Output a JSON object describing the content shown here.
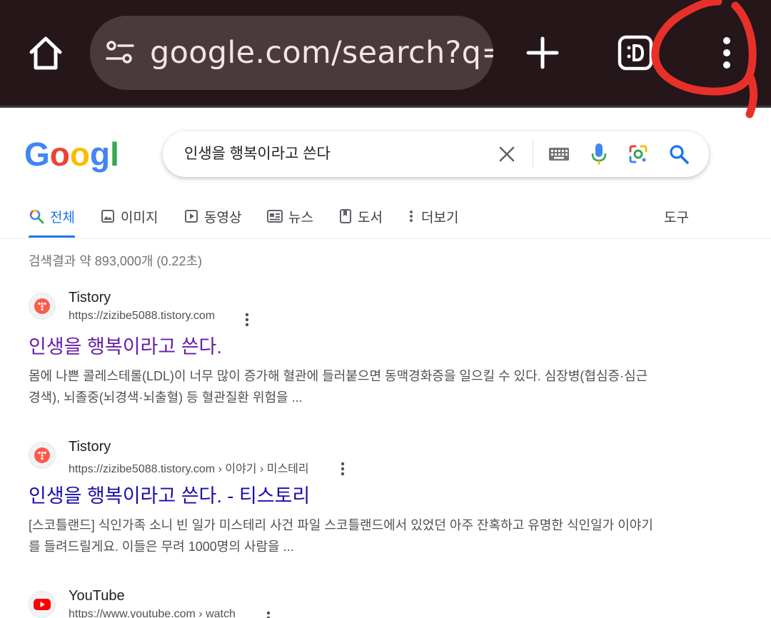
{
  "browser": {
    "url_display": "google.com/search?q=",
    "icons": [
      "home-icon",
      "site-settings-icon",
      "new-tab-icon",
      "tab-switcher-icon",
      "more-vert-icon"
    ],
    "colors": {
      "toolbar": "#241619",
      "url_pill": "#4a3a3c",
      "annotation": "#e8302b"
    }
  },
  "search": {
    "logo_text": "Google",
    "query": "인생을 행복이라고 쓴다"
  },
  "tabs": [
    {
      "label": "전체",
      "icon": "search-icon",
      "active": true
    },
    {
      "label": "이미지",
      "icon": "image-icon"
    },
    {
      "label": "동영상",
      "icon": "video-icon"
    },
    {
      "label": "뉴스",
      "icon": "news-icon"
    },
    {
      "label": "도서",
      "icon": "book-icon"
    },
    {
      "label": "더보기",
      "icon": "more-vert-icon"
    }
  ],
  "tools_label": "도구",
  "result_stats": "검색결과 약 893,000개 (0.22초)",
  "results": [
    {
      "site": "Tistory",
      "url": "https://zizibe5088.tistory.com",
      "title": "인생을 행복이라고 쓴다.",
      "visited": true,
      "snippet": "몸에 나쁜 콜레스테롤(LDL)이 너무 많이 증가해 혈관에 들러붙으면 동맥경화증을 일으킬 수 있다. 심장병(협심증·심근경색), 뇌졸중(뇌경색·뇌출혈) 등 혈관질환 위험을 ..."
    },
    {
      "site": "Tistory",
      "url": "https://zizibe5088.tistory.com › 이야기 › 미스테리",
      "title": "인생을 행복이라고 쓴다. - 티스토리",
      "visited": false,
      "snippet": "[스코틀랜드] 식인가족 소니 빈 일가 미스테리 사건 파일 스코틀랜드에서 있었던 아주 잔혹하고 유명한 식인일가 이야기를 들려드릴게요. 이들은 무려 1000명의 사람을 ..."
    },
    {
      "site": "YouTube",
      "url": "https://www.youtube.com › watch"
    }
  ]
}
